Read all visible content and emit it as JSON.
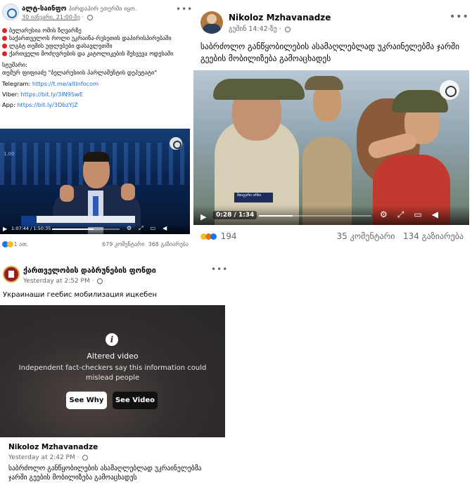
{
  "post1": {
    "author": "ალტ-საინფო",
    "author_sub": "პირდაპირ ეთერში იყო.",
    "date": "30 იანვარი, 21:00-ზე",
    "date_suffix": " · ",
    "bullets": [
      "ბელარუსია ომის ზღვარზე",
      "საქართველოს როლი უკრაინა-რუსეთის დაპირისპირებაში",
      "ლგბტ თემის უფლებები დასავლეთში",
      "ქართველი მოძღვრების და კატოლიკების შეხვევა ოდესაში"
    ],
    "guest_label": "სტუმარი:",
    "guest": "თემურ ფიფიაძე \"ბელარუსიის პარლამენტის დეპუტატი\"",
    "telegram_label": "Telegram: ",
    "telegram_link": "https://t.me/altinfocom",
    "viber_label": "Viber: ",
    "viber_link": "https://bit.ly/3lN9SwE",
    "app_label": "App: ",
    "app_link": "https://bit.ly/3DbzYjZ",
    "video": {
      "side_number": "1.00",
      "time": "1:07:44 / 1:50:35",
      "progress": 0.61
    },
    "reactions_count": "1 ათ.",
    "comments": "679 კომენტარი",
    "shares": "368 გაზიარება"
  },
  "post2": {
    "author": "Nikoloz Mzhavanadze",
    "date": "გუშინ 14:42-ზე",
    "date_suffix": " · ",
    "text": "საბრძოლო განწყობილების ასამაღლებლად უკრაინელებმა ჯარში გეების მობილიზება გამოაცხადეს",
    "video": {
      "logo_text": "მთავარი არხი",
      "time": "0:28 / 1:34",
      "progress": 0.3
    },
    "reactions_count": "194",
    "comments": "35 კომენტარი",
    "shares": "134 გაზიარება"
  },
  "post3": {
    "author": "ქართველობის დაბრუნების ფონდი",
    "date": "Yesterday at 2:52 PM",
    "date_suffix": " · ",
    "text": "Украинаши геебис мобилизация ицкебен",
    "overlay": {
      "title": "Altered video",
      "subtitle": "Independent fact-checkers say this information could mislead people",
      "see_why": "See Why",
      "see_video": "See Video"
    },
    "shared_author": "Nikoloz Mzhavanadze",
    "shared_date": "Yesterday at 2:42 PM",
    "shared_date_suffix": " · ",
    "shared_text": "საბრძოლო განწყობილების ასამაღლებლად უკრაინელებმა ჯარში გეების მობილიზება გამოაცხადეს"
  },
  "icons": {
    "play": "▶",
    "more": "•••"
  },
  "colors": {
    "link": "#216fdb",
    "bullet": "#e02424",
    "muted": "#65676b"
  }
}
